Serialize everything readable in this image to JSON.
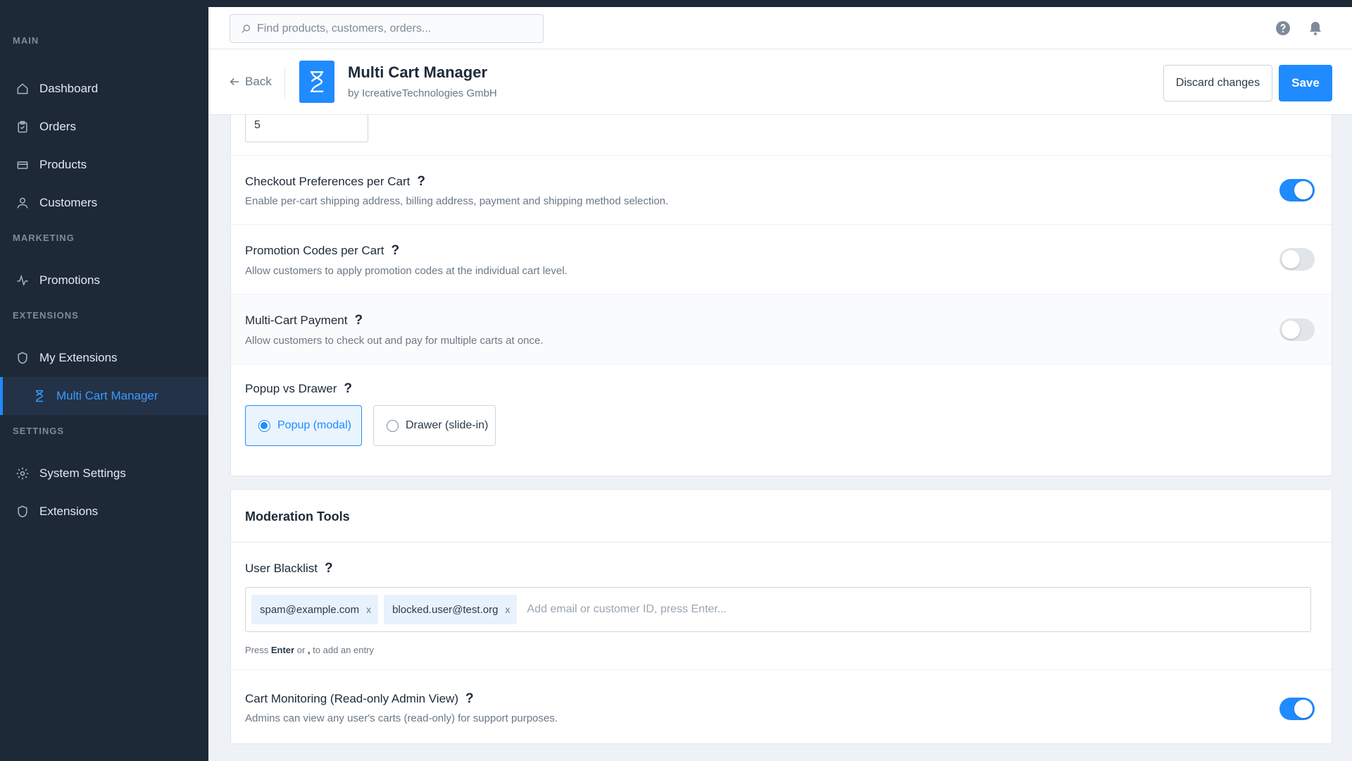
{
  "sidebar": {
    "sections": {
      "main": "MAIN",
      "marketing": "MARKETING",
      "extensions": "EXTENSIONS",
      "settings": "SETTINGS"
    },
    "items": [
      {
        "label": "Dashboard",
        "icon": "home-icon"
      },
      {
        "label": "Orders",
        "icon": "clipboard-icon"
      },
      {
        "label": "Products",
        "icon": "box-icon"
      },
      {
        "label": "Customers",
        "icon": "user-icon"
      },
      {
        "label": "Promotions",
        "icon": "pulse-icon"
      },
      {
        "label": "My Extensions",
        "icon": "shield-icon"
      },
      {
        "label": "Multi Cart Manager",
        "icon": "hourglass-icon",
        "active": true
      },
      {
        "label": "System Settings",
        "icon": "gear-icon"
      },
      {
        "label": "Extensions",
        "icon": "shield-icon"
      }
    ]
  },
  "topbar": {
    "search_placeholder": "Find products, customers, orders..."
  },
  "header": {
    "back_label": "Back",
    "title": "Multi Cart Manager",
    "vendor": "by IcreativeTechnologies GmbH",
    "discard_label": "Discard changes",
    "save_label": "Save"
  },
  "settings": {
    "number_value": "5",
    "checkout_prefs": {
      "title": "Checkout Preferences per Cart",
      "desc": "Enable per-cart shipping address, billing address, payment and shipping method selection.",
      "enabled": true
    },
    "promo_codes": {
      "title": "Promotion Codes per Cart",
      "desc": "Allow customers to apply promotion codes at the individual cart level.",
      "enabled": false
    },
    "multi_payment": {
      "title": "Multi-Cart Payment",
      "desc": "Allow customers to check out and pay for multiple carts at once.",
      "enabled": false
    },
    "popup_drawer": {
      "title": "Popup vs Drawer",
      "options": [
        "Popup (modal)",
        "Drawer (slide-in)"
      ],
      "selected": "Popup (modal)"
    }
  },
  "moderation": {
    "heading": "Moderation Tools",
    "blacklist": {
      "title": "User Blacklist",
      "tags": [
        "spam@example.com",
        "blocked.user@test.org"
      ],
      "placeholder": "Add email or customer ID, press Enter...",
      "hint_prefix": "Press",
      "hint_key1": "Enter",
      "hint_mid": "or",
      "hint_key2": ",",
      "hint_suffix": "to add an entry"
    },
    "monitoring": {
      "title": "Cart Monitoring (Read-only Admin View)",
      "desc": "Admins can view any user's carts (read-only) for support purposes.",
      "enabled": true
    }
  },
  "help_glyph": "?",
  "tag_remove_glyph": "x",
  "colors": {
    "accent": "#1f8bff",
    "sidebar_bg": "#1e2938"
  }
}
